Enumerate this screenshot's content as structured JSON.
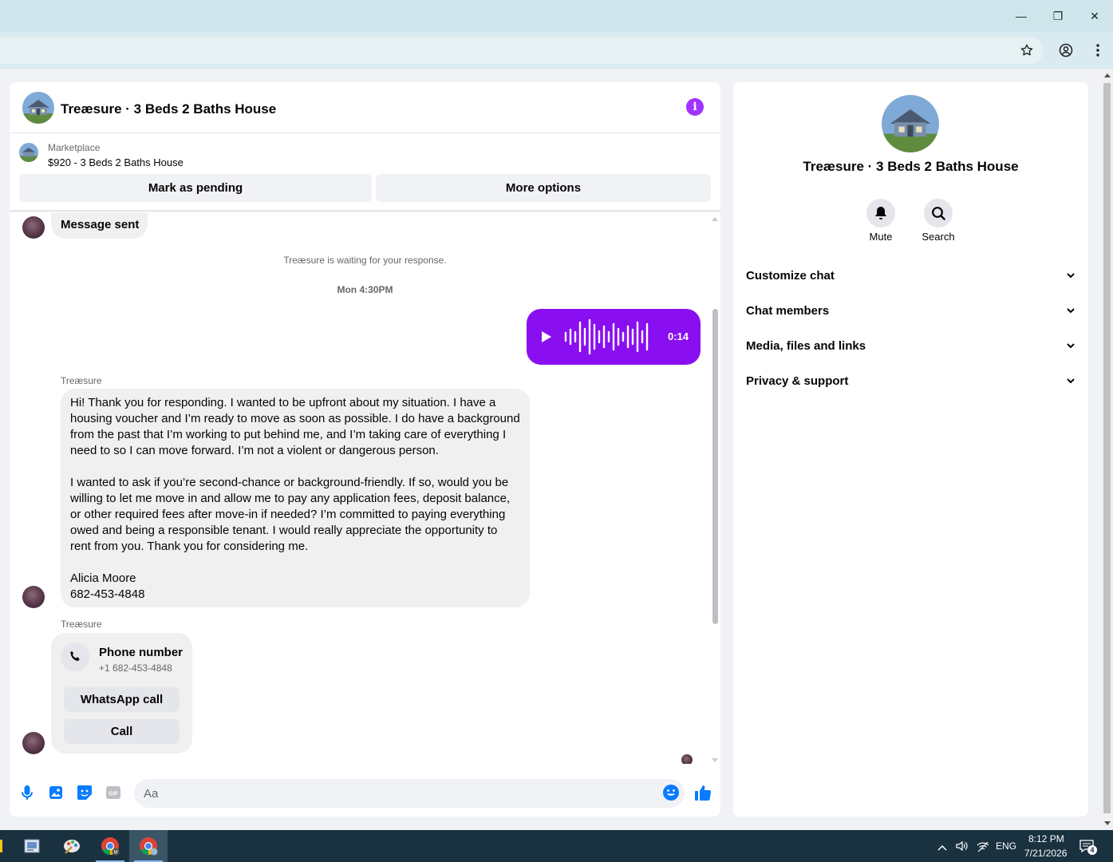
{
  "browser": {
    "minimize": "—",
    "restore": "❐",
    "close": "✕"
  },
  "chat": {
    "title": "Treæsure · 3 Beds 2 Baths House",
    "marketplace_label": "Marketplace",
    "listing": "$920 - 3 Beds 2 Baths House",
    "mark_pending": "Mark as pending",
    "more_options": "More options",
    "message_sent": "Message sent",
    "waiting_notice": "Treæsure is waiting for your response.",
    "timestamp": "Mon 4:30PM",
    "voice_duration": "0:14",
    "sender_name_1": "Treæsure",
    "long_message": "Hi! Thank you for responding. I wanted to be upfront about my situation. I have a housing voucher and I’m ready to move as soon as possible. I do have a background from the past that I’m working to put behind me, and I’m taking care of everything I need to so I can move forward. I’m not a violent or dangerous person.\n\nI wanted to ask if you’re second-chance or background-friendly. If so, would you be willing to let me move in and allow me to pay any application fees, deposit balance, or other required fees after move-in if needed? I’m committed to paying everything owed and being a responsible tenant. I would really appreciate the opportunity to rent from you. Thank you for considering me.\n\nAlicia Moore\n682-453-4848",
    "sender_name_2": "Treæsure",
    "phone_card": {
      "title": "Phone number",
      "number": "+1 682-453-4848",
      "whatsapp": "WhatsApp call",
      "call": "Call"
    },
    "input_placeholder": "Aa"
  },
  "side": {
    "title": "Treæsure · 3 Beds 2 Baths House",
    "mute": "Mute",
    "search": "Search",
    "sections": [
      "Customize chat",
      "Chat members",
      "Media, files and links",
      "Privacy & support"
    ]
  },
  "taskbar": {
    "lang": "ENG",
    "time": "8:12 PM",
    "date": "7/21/2026",
    "notifications": "4"
  },
  "colors": {
    "accent": "#8a0ff0",
    "like_blue": "#0a7cff"
  }
}
